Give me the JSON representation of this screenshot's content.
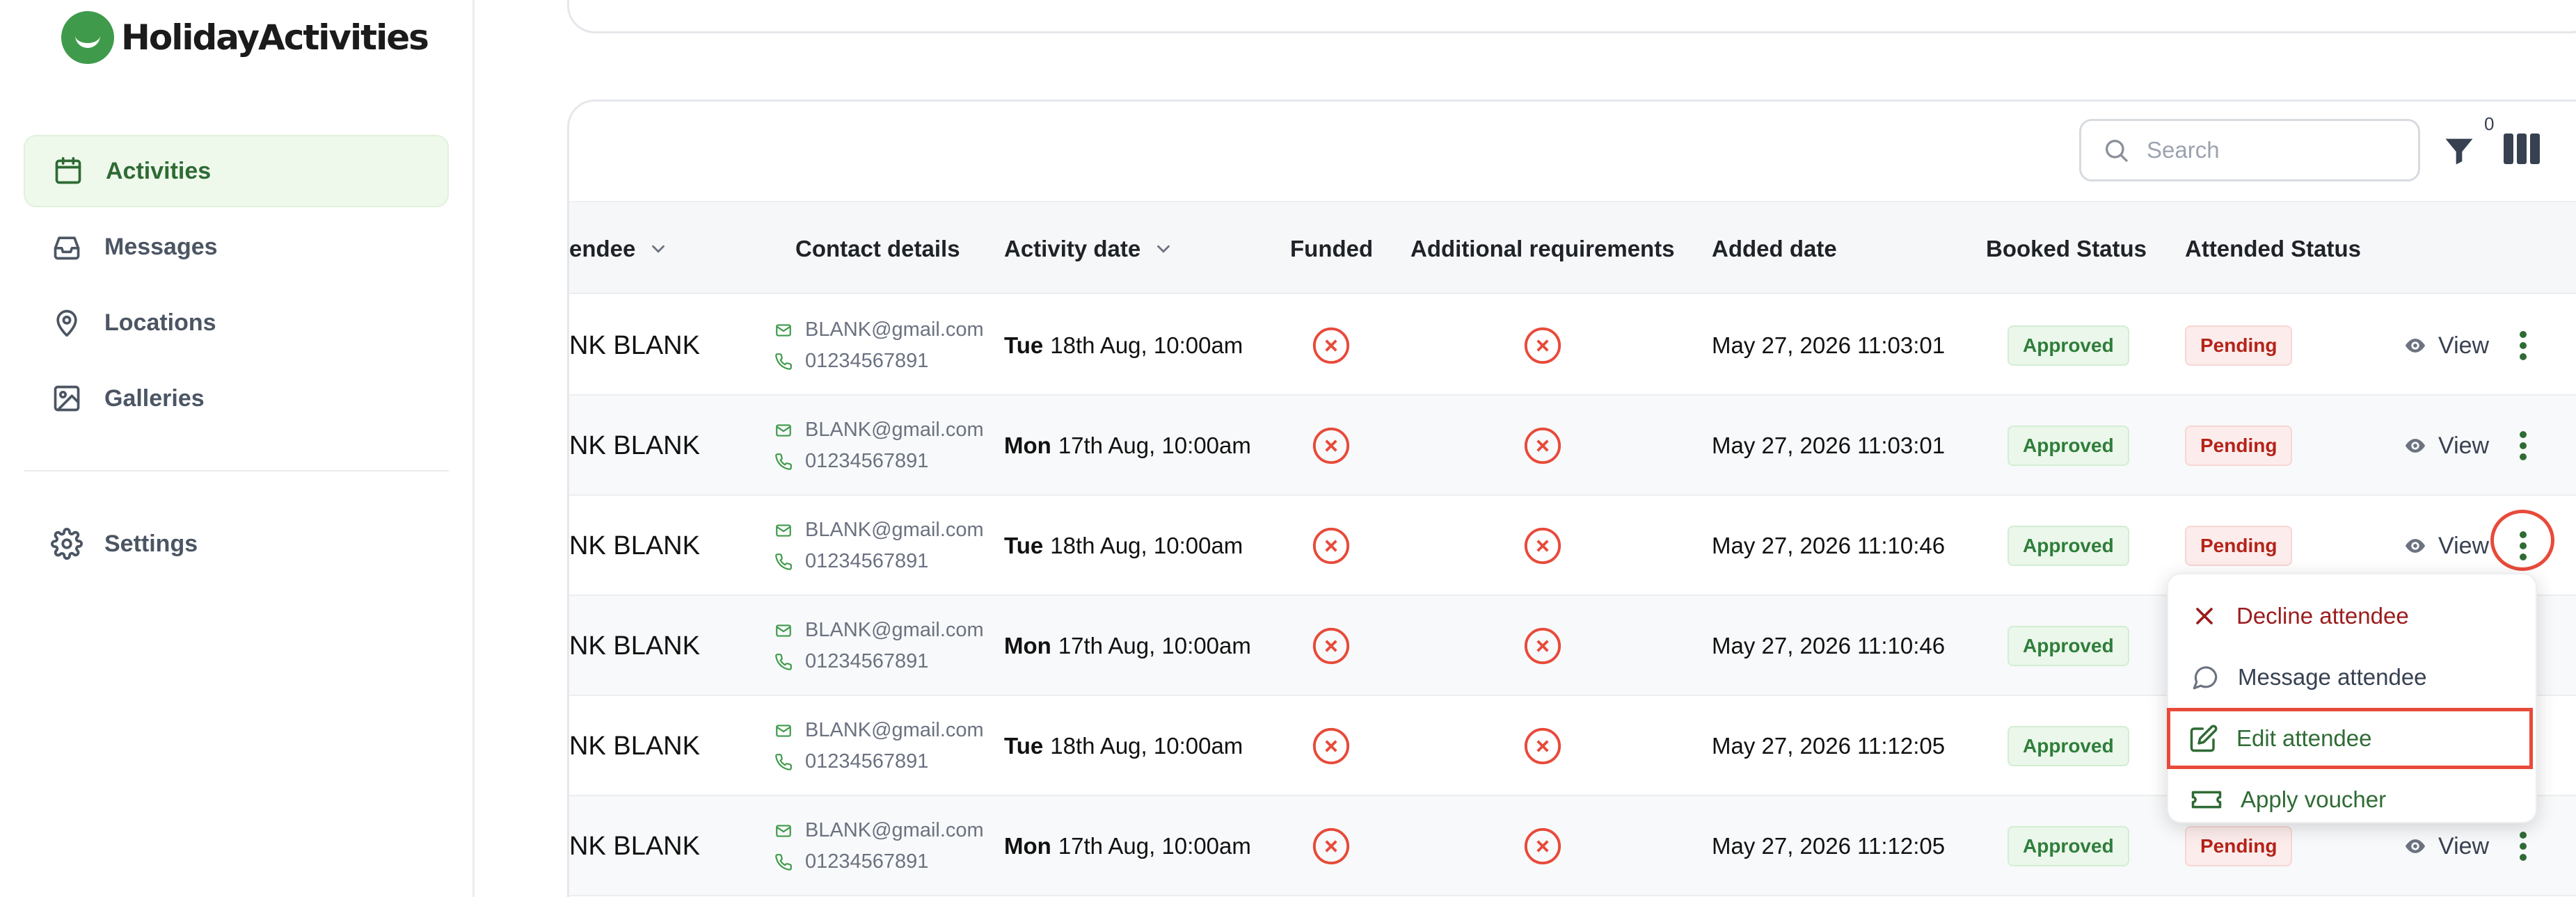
{
  "brand": {
    "name": "HolidayActivities"
  },
  "sidebar": {
    "items": [
      {
        "label": "Activities",
        "icon": "calendar-icon",
        "active": true
      },
      {
        "label": "Messages",
        "icon": "inbox-icon",
        "active": false
      },
      {
        "label": "Locations",
        "icon": "map-pin-icon",
        "active": false
      },
      {
        "label": "Galleries",
        "icon": "image-icon",
        "active": false
      }
    ],
    "settings": {
      "label": "Settings",
      "icon": "gear-icon"
    }
  },
  "toolbar": {
    "search_placeholder": "Search",
    "filter_count": "0"
  },
  "table": {
    "columns": {
      "attendee": "endee",
      "contact": "Contact details",
      "activity_date": "Activity date",
      "funded": "Funded",
      "additional": "Additional requirements",
      "added": "Added date",
      "booked": "Booked Status",
      "attended": "Attended Status"
    },
    "view_label": "View",
    "rows": [
      {
        "name": "NK BLANK",
        "email": "BLANK@gmail.com",
        "phone": "01234567891",
        "day": "Tue",
        "date": "18th Aug, 10:00am",
        "added": "May 27, 2026 11:03:01",
        "booked": "Approved",
        "attended": "Pending"
      },
      {
        "name": "NK BLANK",
        "email": "BLANK@gmail.com",
        "phone": "01234567891",
        "day": "Mon",
        "date": "17th Aug, 10:00am",
        "added": "May 27, 2026 11:03:01",
        "booked": "Approved",
        "attended": "Pending"
      },
      {
        "name": "NK BLANK",
        "email": "BLANK@gmail.com",
        "phone": "01234567891",
        "day": "Tue",
        "date": "18th Aug, 10:00am",
        "added": "May 27, 2026 11:10:46",
        "booked": "Approved",
        "attended": "Pending"
      },
      {
        "name": "NK BLANK",
        "email": "BLANK@gmail.com",
        "phone": "01234567891",
        "day": "Mon",
        "date": "17th Aug, 10:00am",
        "added": "May 27, 2026 11:10:46",
        "booked": "Approved",
        "attended": ""
      },
      {
        "name": "NK BLANK",
        "email": "BLANK@gmail.com",
        "phone": "01234567891",
        "day": "Tue",
        "date": "18th Aug, 10:00am",
        "added": "May 27, 2026 11:12:05",
        "booked": "Approved",
        "attended": ""
      },
      {
        "name": "NK BLANK",
        "email": "BLANK@gmail.com",
        "phone": "01234567891",
        "day": "Mon",
        "date": "17th Aug, 10:00am",
        "added": "May 27, 2026 11:12:05",
        "booked": "Approved",
        "attended": "Pending"
      }
    ]
  },
  "menu": {
    "decline": "Decline attendee",
    "message": "Message attendee",
    "edit": "Edit attendee",
    "voucher": "Apply voucher"
  },
  "colors": {
    "brand_green": "#3f9a4b",
    "active_bg": "#eef9ec",
    "danger_red": "#e84a3a",
    "highlight": "#e84a3a"
  }
}
